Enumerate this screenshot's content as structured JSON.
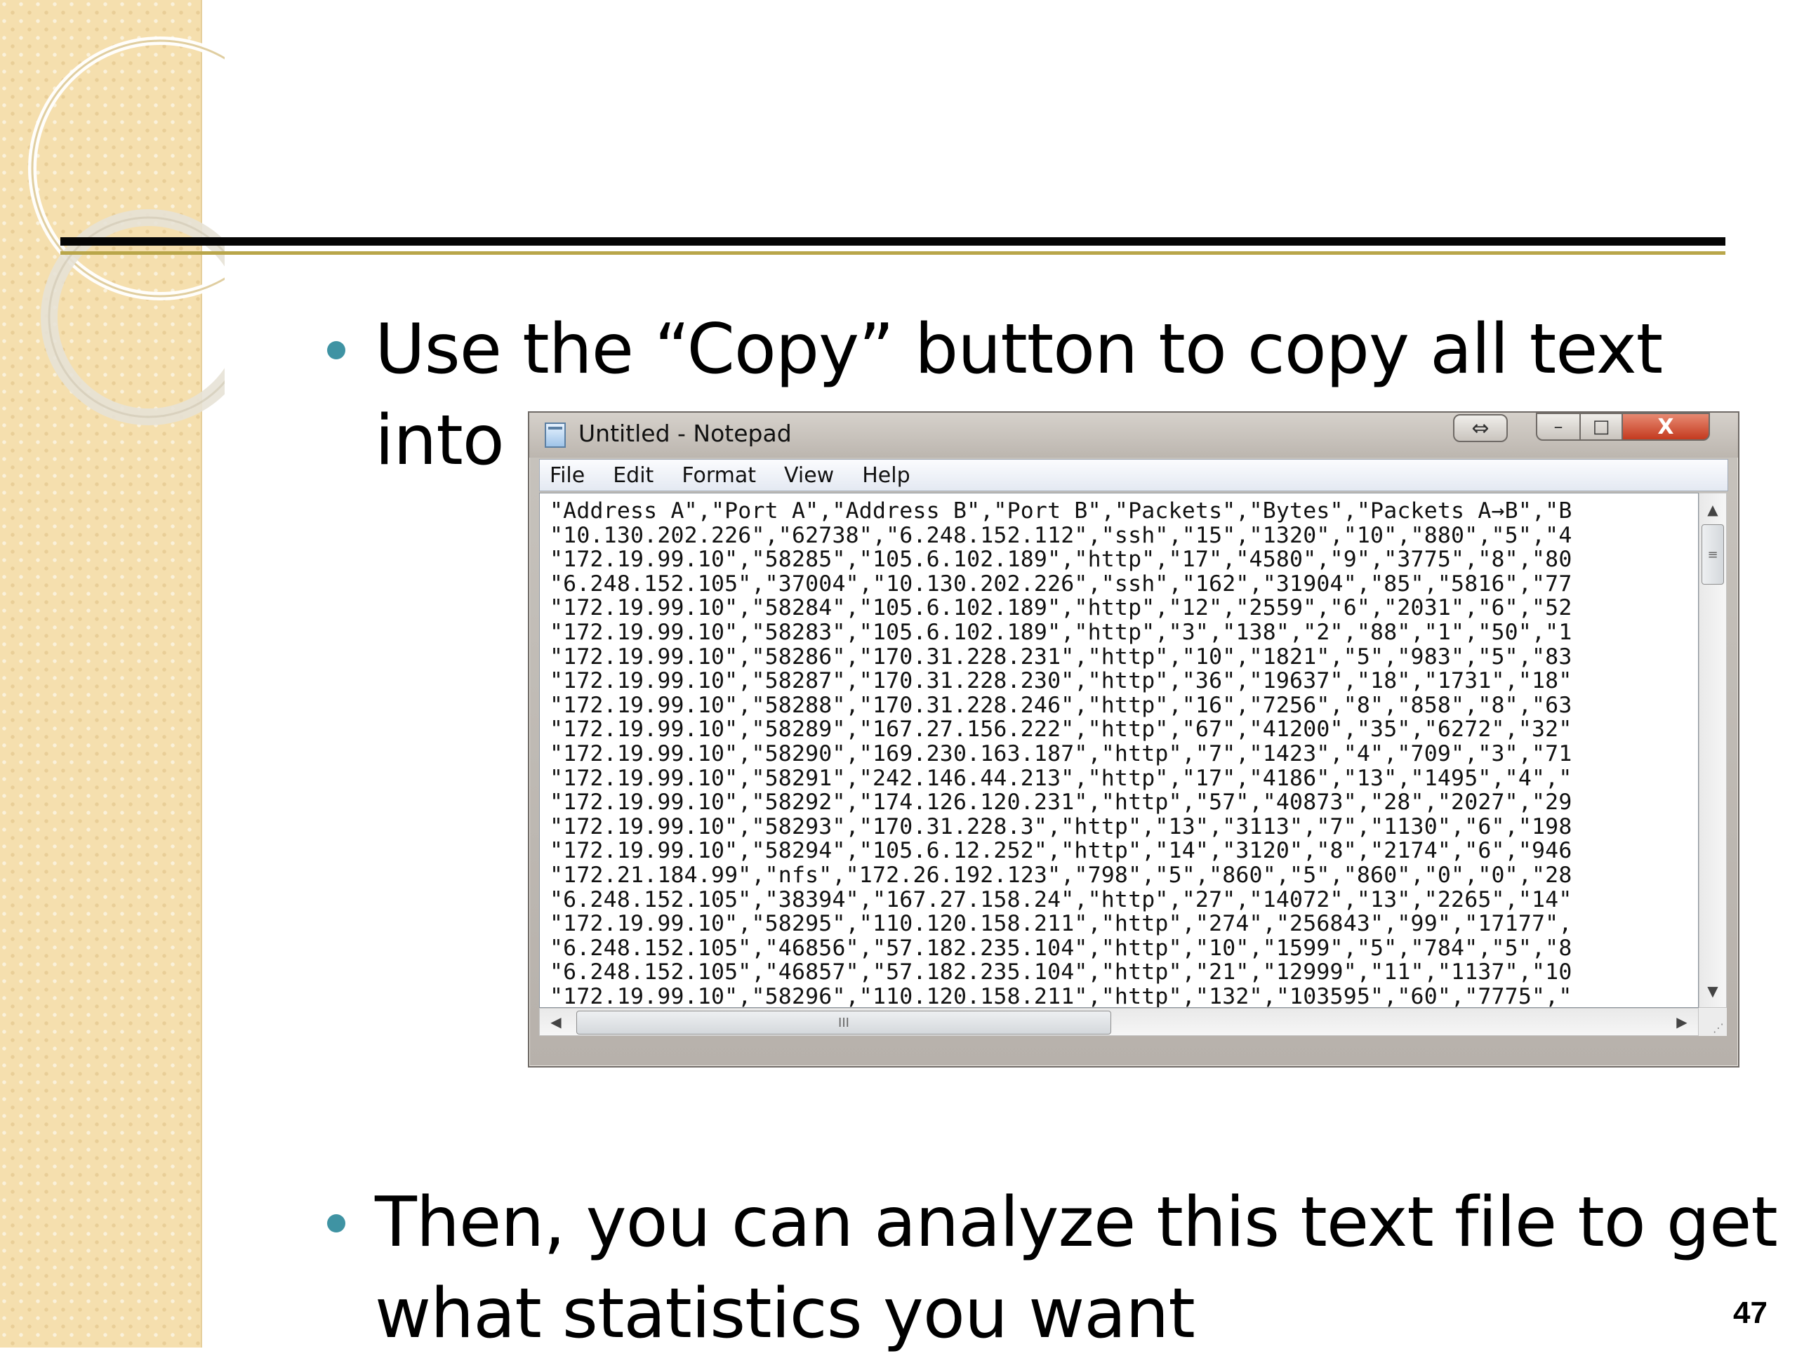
{
  "slide": {
    "bullet1_line1": "Use the “Copy” button to copy all text",
    "bullet1_line2": "into",
    "bullet2_line1": "Then, you can analyze this text file to get",
    "bullet2_line2": "what statistics you want",
    "page_number": "47"
  },
  "notepad": {
    "title": "Untitled - Notepad",
    "menu": [
      "File",
      "Edit",
      "Format",
      "View",
      "Help"
    ],
    "buttons": {
      "resize": "⇔",
      "minimize": "–",
      "maximize": "□",
      "close": "X"
    },
    "lines": [
      "\"Address A\",\"Port A\",\"Address B\",\"Port B\",\"Packets\",\"Bytes\",\"Packets A→B\",\"B",
      "\"10.130.202.226\",\"62738\",\"6.248.152.112\",\"ssh\",\"15\",\"1320\",\"10\",\"880\",\"5\",\"4",
      "\"172.19.99.10\",\"58285\",\"105.6.102.189\",\"http\",\"17\",\"4580\",\"9\",\"3775\",\"8\",\"80",
      "\"6.248.152.105\",\"37004\",\"10.130.202.226\",\"ssh\",\"162\",\"31904\",\"85\",\"5816\",\"77",
      "\"172.19.99.10\",\"58284\",\"105.6.102.189\",\"http\",\"12\",\"2559\",\"6\",\"2031\",\"6\",\"52",
      "\"172.19.99.10\",\"58283\",\"105.6.102.189\",\"http\",\"3\",\"138\",\"2\",\"88\",\"1\",\"50\",\"1",
      "\"172.19.99.10\",\"58286\",\"170.31.228.231\",\"http\",\"10\",\"1821\",\"5\",\"983\",\"5\",\"83",
      "\"172.19.99.10\",\"58287\",\"170.31.228.230\",\"http\",\"36\",\"19637\",\"18\",\"1731\",\"18\"",
      "\"172.19.99.10\",\"58288\",\"170.31.228.246\",\"http\",\"16\",\"7256\",\"8\",\"858\",\"8\",\"63",
      "\"172.19.99.10\",\"58289\",\"167.27.156.222\",\"http\",\"67\",\"41200\",\"35\",\"6272\",\"32\"",
      "\"172.19.99.10\",\"58290\",\"169.230.163.187\",\"http\",\"7\",\"1423\",\"4\",\"709\",\"3\",\"71",
      "\"172.19.99.10\",\"58291\",\"242.146.44.213\",\"http\",\"17\",\"4186\",\"13\",\"1495\",\"4\",\"",
      "\"172.19.99.10\",\"58292\",\"174.126.120.231\",\"http\",\"57\",\"40873\",\"28\",\"2027\",\"29",
      "\"172.19.99.10\",\"58293\",\"170.31.228.3\",\"http\",\"13\",\"3113\",\"7\",\"1130\",\"6\",\"198",
      "\"172.19.99.10\",\"58294\",\"105.6.12.252\",\"http\",\"14\",\"3120\",\"8\",\"2174\",\"6\",\"946",
      "\"172.21.184.99\",\"nfs\",\"172.26.192.123\",\"798\",\"5\",\"860\",\"5\",\"860\",\"0\",\"0\",\"28",
      "\"6.248.152.105\",\"38394\",\"167.27.158.24\",\"http\",\"27\",\"14072\",\"13\",\"2265\",\"14\"",
      "\"172.19.99.10\",\"58295\",\"110.120.158.211\",\"http\",\"274\",\"256843\",\"99\",\"17177\",",
      "\"6.248.152.105\",\"46856\",\"57.182.235.104\",\"http\",\"10\",\"1599\",\"5\",\"784\",\"5\",\"8",
      "\"6.248.152.105\",\"46857\",\"57.182.235.104\",\"http\",\"21\",\"12999\",\"11\",\"1137\",\"10",
      "\"172.19.99.10\",\"58296\",\"110.120.158.211\",\"http\",\"132\",\"103595\",\"60\",\"7775\",\""
    ],
    "scrollbar_grip": "≡",
    "hscroll_grip": "III"
  },
  "colors": {
    "bullet": "#3f93a3",
    "side_strip": "#f5dfae",
    "rule_accent": "#b9a64a",
    "close_button": "#c43a1f"
  },
  "icons": [
    "notepad-icon",
    "arrow-up-icon",
    "arrow-down-icon",
    "arrow-left-icon",
    "arrow-right-icon",
    "resize-grip-icon"
  ]
}
